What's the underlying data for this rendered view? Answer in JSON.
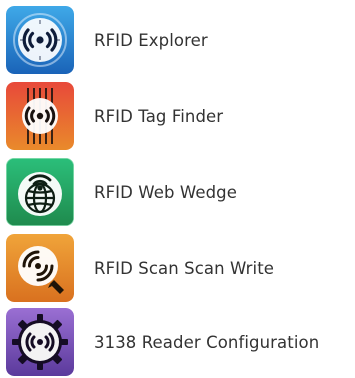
{
  "apps": [
    {
      "label": "RFID Explorer",
      "icon": "rfid-explorer-icon",
      "colors": {
        "top": "#3fa9e8",
        "bottom": "#1a63b8",
        "glyph": "#0f1d3a"
      }
    },
    {
      "label": "RFID Tag Finder",
      "icon": "rfid-tag-finder-icon",
      "colors": {
        "top": "#e8493a",
        "bottom": "#e98a2b",
        "glyph": "#1a1210"
      }
    },
    {
      "label": "RFID Web Wedge",
      "icon": "rfid-web-wedge-icon",
      "colors": {
        "top": "#2bbf7a",
        "bottom": "#1f8a4d",
        "glyph": "#0e1f14"
      }
    },
    {
      "label": "RFID Scan Scan Write",
      "icon": "rfid-scan-write-icon",
      "colors": {
        "top": "#f0a43a",
        "bottom": "#d9711f",
        "glyph": "#1f1408"
      }
    },
    {
      "label": "3138 Reader Configuration",
      "icon": "reader-configuration-icon",
      "colors": {
        "top": "#9a6fd3",
        "bottom": "#5b3a9c",
        "glyph": "#150c24"
      }
    }
  ]
}
